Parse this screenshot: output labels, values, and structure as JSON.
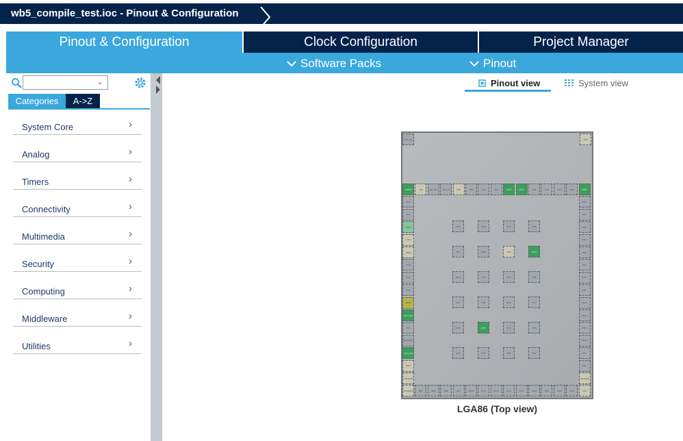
{
  "title": "wb5_compile_test.ioc - Pinout & Configuration",
  "tabs": [
    {
      "label": "Pinout & Configuration"
    },
    {
      "label": "Clock Configuration"
    },
    {
      "label": "Project Manager"
    }
  ],
  "subbar": {
    "software_packs": "Software Packs",
    "pinout": "Pinout"
  },
  "sidebar": {
    "search_value": "",
    "cat_tab": "Categories",
    "az_tab": "A->Z",
    "items": [
      {
        "label": "System Core"
      },
      {
        "label": "Analog"
      },
      {
        "label": "Timers"
      },
      {
        "label": "Connectivity"
      },
      {
        "label": "Multimedia"
      },
      {
        "label": "Security"
      },
      {
        "label": "Computing"
      },
      {
        "label": "Middleware"
      },
      {
        "label": "Utilities"
      }
    ]
  },
  "views": {
    "pinout": "Pinout view",
    "system": "System view"
  },
  "chip": {
    "label": "LGA86 (Top view)",
    "colors": {
      "gray": "#a3a8ae",
      "tan": "#c9c8b2",
      "green": "#3f9e5c",
      "lgreen": "#8ac59a",
      "olive": "#b3b54a"
    },
    "corner_pins": [
      {
        "label": "ANT_NC",
        "type": "gray"
      },
      {
        "label": "VSS",
        "type": "tan"
      }
    ],
    "top_row": [
      {
        "label": "VDDRF",
        "type": "green"
      },
      {
        "label": "VSS",
        "type": "tan"
      },
      {
        "label": "RF_OUT",
        "type": "gray"
      },
      {
        "label": "ANT_IN",
        "type": "gray"
      },
      {
        "label": "VSS",
        "type": "tan"
      },
      {
        "label": "PA4",
        "type": "gray"
      },
      {
        "label": "PA4",
        "type": "gray"
      },
      {
        "label": "PA4",
        "type": "gray"
      },
      {
        "label": "GPIO",
        "type": "green"
      },
      {
        "label": "GPIO",
        "type": "green"
      },
      {
        "label": "PA8",
        "type": "gray"
      },
      {
        "label": "PA9",
        "type": "gray"
      },
      {
        "label": "PC4",
        "type": "gray"
      },
      {
        "label": "PB2",
        "type": "gray"
      },
      {
        "label": "GPIO",
        "type": "green"
      }
    ],
    "left_col": [
      {
        "label": "PA1",
        "type": "gray"
      },
      {
        "label": "PA2",
        "type": "gray"
      },
      {
        "label": "VREF+",
        "type": "lgreen"
      },
      {
        "label": "VSS",
        "type": "tan"
      },
      {
        "label": "VDDA",
        "type": "tan"
      },
      {
        "label": "PC0",
        "type": "gray"
      },
      {
        "label": "PC2",
        "type": "gray"
      },
      {
        "label": "PC1",
        "type": "gray"
      },
      {
        "label": "NRST",
        "type": "olive"
      },
      {
        "label": "I2C1_SCL",
        "type": "green"
      },
      {
        "label": "PC3",
        "type": "gray"
      },
      {
        "label": "PH3-BOOT0",
        "type": "gray"
      },
      {
        "label": "I2C1_SDA",
        "type": "green"
      },
      {
        "label": "VBAT",
        "type": "tan"
      },
      {
        "label": "VSSSMPS",
        "type": "tan"
      }
    ],
    "right_col": [
      {
        "label": "PB11",
        "type": "gray"
      },
      {
        "label": "PC0",
        "type": "gray"
      },
      {
        "label": "PB0",
        "type": "gray"
      },
      {
        "label": "PB1",
        "type": "gray"
      },
      {
        "label": "PB2",
        "type": "gray"
      },
      {
        "label": "PE4",
        "type": "gray"
      },
      {
        "label": "PC10",
        "type": "gray"
      },
      {
        "label": "PB6",
        "type": "gray"
      },
      {
        "label": "PB15",
        "type": "gray"
      },
      {
        "label": "PB10",
        "type": "gray"
      },
      {
        "label": "PC5",
        "type": "gray"
      },
      {
        "label": "PB13",
        "type": "gray"
      },
      {
        "label": "PD1",
        "type": "gray"
      },
      {
        "label": "PD0",
        "type": "gray"
      },
      {
        "label": "VSSSMPS",
        "type": "tan"
      }
    ],
    "bottom_row": [
      {
        "label": "VDDSMPS",
        "type": "tan"
      },
      {
        "label": "PB7",
        "type": "gray"
      },
      {
        "label": "PB4",
        "type": "gray"
      },
      {
        "label": "PB4",
        "type": "gray"
      },
      {
        "label": "PB3",
        "type": "gray"
      },
      {
        "label": "PA15",
        "type": "gray"
      },
      {
        "label": "PC11",
        "type": "gray"
      },
      {
        "label": "PC12",
        "type": "gray"
      },
      {
        "label": "PA13",
        "type": "gray"
      },
      {
        "label": "PA14",
        "type": "gray"
      },
      {
        "label": "PA10",
        "type": "gray"
      },
      {
        "label": "PB9",
        "type": "gray"
      },
      {
        "label": "PA12",
        "type": "gray"
      },
      {
        "label": "PA11",
        "type": "gray"
      },
      {
        "label": "VSS",
        "type": "tan"
      }
    ],
    "inner": [
      [
        {
          "label": "PA6",
          "type": "gray"
        },
        {
          "label": "PD15",
          "type": "gray"
        },
        {
          "label": "PC6",
          "type": "gray"
        },
        {
          "label": "PB8",
          "type": "gray"
        }
      ],
      [
        {
          "label": "PA5",
          "type": "gray"
        },
        {
          "label": "PD13",
          "type": "gray"
        },
        {
          "label": "VSS",
          "type": "tan"
        },
        {
          "label": "GPIO",
          "type": "green"
        }
      ],
      [
        {
          "label": "PD14",
          "type": "gray"
        },
        {
          "label": "PA3",
          "type": "gray"
        },
        {
          "label": "PC9",
          "type": "gray"
        },
        {
          "label": "PB3",
          "type": "gray"
        }
      ],
      [
        {
          "label": "PE1",
          "type": "gray"
        },
        {
          "label": "PE0",
          "type": "gray"
        },
        {
          "label": "PD11",
          "type": "gray"
        },
        {
          "label": "PC7",
          "type": "gray"
        }
      ],
      [
        {
          "label": "PD12",
          "type": "gray"
        },
        {
          "label": "GPIO",
          "type": "green"
        },
        {
          "label": "PD4",
          "type": "gray"
        },
        {
          "label": "PD5",
          "type": "gray"
        }
      ],
      [
        {
          "label": "PD9",
          "type": "gray"
        },
        {
          "label": "PD7",
          "type": "gray"
        },
        {
          "label": "PD8",
          "type": "gray"
        },
        {
          "label": "PC8",
          "type": "gray"
        }
      ]
    ]
  }
}
